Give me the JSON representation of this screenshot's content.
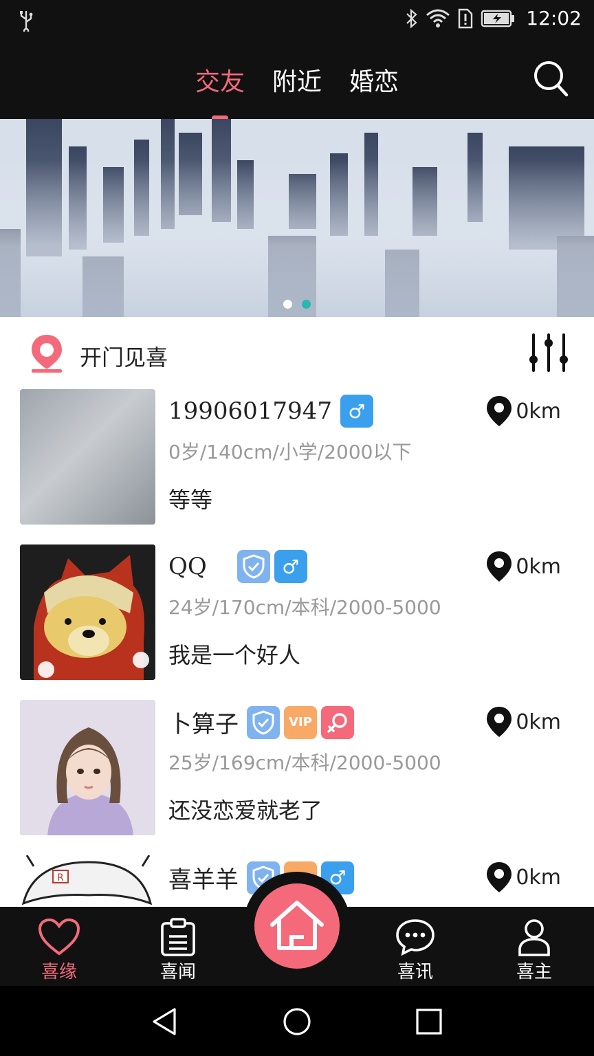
{
  "status_bar": {
    "time": "12:02",
    "icons": [
      "usb-icon",
      "bluetooth-icon",
      "wifi-icon",
      "sim-alert-icon",
      "battery-charging-icon"
    ]
  },
  "top_nav": {
    "tabs": [
      {
        "label": "交友",
        "active": true
      },
      {
        "label": "附近",
        "active": false
      },
      {
        "label": "婚恋",
        "active": false
      }
    ],
    "search_icon": "search-icon"
  },
  "banner": {
    "slides": 2,
    "active_index": 1
  },
  "section": {
    "title": "开门见喜",
    "logo_icon": "location-pin-icon",
    "filter_icon": "sliders-icon"
  },
  "users": [
    {
      "name": "19906017947",
      "badges": [
        "male"
      ],
      "stats": "0岁/140cm/小学/2000以下",
      "bio": "等等",
      "distance": "0km"
    },
    {
      "name": "QQ",
      "badges": [
        "verified",
        "male"
      ],
      "stats": "24岁/170cm/本科/2000-5000",
      "bio": "我是一个好人",
      "distance": "0km"
    },
    {
      "name": "卜算子",
      "badges": [
        "verified",
        "vip",
        "female"
      ],
      "vip_label": "VIP",
      "stats": "25岁/169cm/本科/2000-5000",
      "bio": "还没恋爱就老了",
      "distance": "0km"
    },
    {
      "name": "喜羊羊",
      "badges": [
        "verified",
        "vip",
        "male"
      ],
      "stats": "",
      "bio": "",
      "distance": "0km"
    }
  ],
  "bottom_nav": {
    "items": [
      {
        "label": "喜缘",
        "icon": "heart-icon",
        "active": true
      },
      {
        "label": "喜闻",
        "icon": "clipboard-icon",
        "active": false
      },
      {
        "label": "",
        "icon": "home-icon",
        "active": false
      },
      {
        "label": "喜讯",
        "icon": "chat-bubble-icon",
        "active": false
      },
      {
        "label": "喜主",
        "icon": "user-icon",
        "active": false
      }
    ]
  },
  "colors": {
    "accent": "#f46a7b",
    "bar_bg": "#111111",
    "male_badge": "#3aa0ee",
    "verify_badge": "#7fb3ef",
    "vip_badge": "#f9a966",
    "stats_text": "#999999"
  }
}
